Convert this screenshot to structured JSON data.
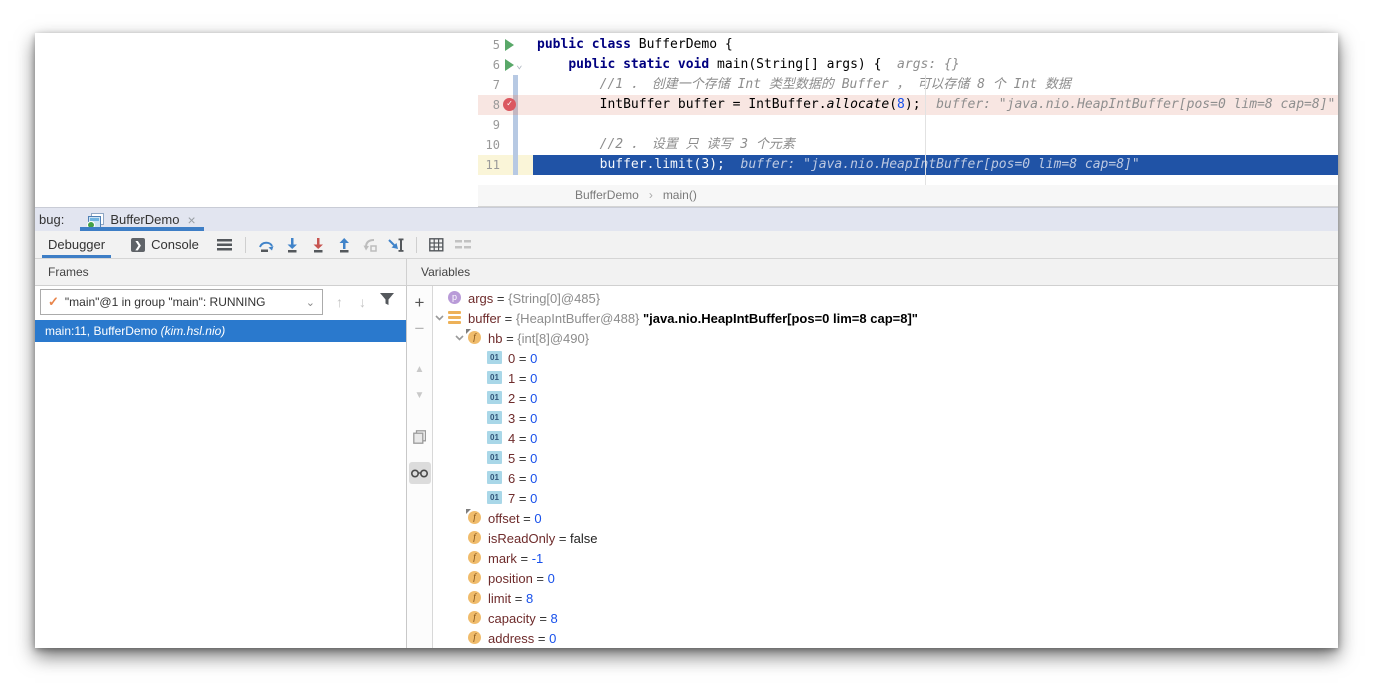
{
  "colors": {
    "accent_blue": "#3E7EC6",
    "exec_line_bg": "#2053A6",
    "breakpoint_line_bg": "#F8E6E2",
    "frame_selection": "#2A79CD",
    "header_lavender": "#E2E5F0",
    "toolbar_gray": "#F2F2F2",
    "keyword": "#000080",
    "number": "#1750EB",
    "comment": "#8C8C8C",
    "var_name": "#6E2B2B",
    "breakpoint_icon": "#DB5860",
    "run_icon": "#59A869"
  },
  "glyphs": {
    "close": "×",
    "chevron_down": "⌄",
    "up_arrow": "↑",
    "down_arrow": "↓",
    "plus": "+",
    "minus": "−",
    "tri_up": "▲",
    "tri_down": "▼",
    "check": "✓",
    "breadcrumb_sep": "›",
    "console_play": "❯",
    "fold": "⌄"
  },
  "editor": {
    "lines": [
      {
        "num": "5",
        "icon": "run",
        "stripe": false,
        "variant": "normal",
        "tokens": [
          {
            "t": "public class ",
            "c": "kw"
          },
          {
            "t": "BufferDemo {",
            "c": "pl"
          }
        ]
      },
      {
        "num": "6",
        "icon": "run",
        "fold": true,
        "stripe": false,
        "variant": "normal",
        "tokens": [
          {
            "t": "    ",
            "c": "pl"
          },
          {
            "t": "public static void ",
            "c": "kw"
          },
          {
            "t": "main(String[] args) {",
            "c": "pl"
          },
          {
            "t": "  args: {}",
            "c": "hint"
          }
        ]
      },
      {
        "num": "7",
        "icon": "",
        "stripe": true,
        "variant": "normal",
        "tokens": [
          {
            "t": "        //1 ． 创建一个存储 Int 类型数据的 Buffer ， 可以存储 8 个 Int 数据",
            "c": "cmt"
          }
        ]
      },
      {
        "num": "8",
        "icon": "bp",
        "stripe": true,
        "variant": "bp",
        "tokens": [
          {
            "t": "        IntBuffer buffer = IntBuffer.",
            "c": "pl"
          },
          {
            "t": "allocate",
            "c": "it"
          },
          {
            "t": "(",
            "c": "pl"
          },
          {
            "t": "8",
            "c": "num"
          },
          {
            "t": ");",
            "c": "pl"
          },
          {
            "t": "  buffer: \"java.nio.HeapIntBuffer[pos=0 lim=8 cap=8]\"",
            "c": "hint"
          }
        ]
      },
      {
        "num": "9",
        "icon": "",
        "stripe": true,
        "variant": "normal",
        "tokens": []
      },
      {
        "num": "10",
        "icon": "",
        "stripe": true,
        "variant": "normal",
        "tokens": [
          {
            "t": "        //2 ． 设置 只 读写 3 个元素",
            "c": "cmt"
          }
        ]
      },
      {
        "num": "11",
        "icon": "",
        "stripe": true,
        "variant": "exec",
        "tokens": [
          {
            "t": "        buffer.limit(",
            "c": "pl"
          },
          {
            "t": "3",
            "c": "num"
          },
          {
            "t": ");",
            "c": "pl"
          },
          {
            "t": "  buffer: \"java.nio.HeapIntBuffer[pos=0 lim=8 cap=8]\"",
            "c": "hint"
          }
        ]
      }
    ],
    "breadcrumb": {
      "class": "BufferDemo",
      "method": "main()"
    }
  },
  "debug_header": {
    "label": "bug:",
    "tab_title": "BufferDemo"
  },
  "toolbar": {
    "debugger_tab": "Debugger",
    "console_tab": "Console",
    "icons": [
      "hamburger-menu",
      "step-over",
      "step-into",
      "force-step-into",
      "step-out",
      "drop-frame",
      "run-to-cursor",
      "view-breakpoints-grid",
      "restore-layout"
    ]
  },
  "panel_headers": {
    "frames": "Frames",
    "variables": "Variables"
  },
  "frames_panel": {
    "thread_selector": "\"main\"@1 in group \"main\": RUNNING",
    "frames": [
      {
        "location": "main:11, BufferDemo ",
        "package": "(kim.hsl.nio)",
        "selected": true
      }
    ]
  },
  "variables_panel": {
    "toolbar": [
      "add-watch",
      "remove-watch",
      "move-up",
      "move-down",
      "duplicate",
      "show-watches"
    ],
    "rows": [
      {
        "level": 0,
        "expand": null,
        "icon": "p",
        "name": "args",
        "value": [
          {
            "t": "{String[0]@485}",
            "c": "ref"
          }
        ]
      },
      {
        "level": 0,
        "expand": "open",
        "icon": "bars",
        "name": "buffer",
        "value": [
          {
            "t": "{HeapIntBuffer@488} ",
            "c": "ref"
          },
          {
            "t": "\"java.nio.HeapIntBuffer[pos=0 lim=8 cap=8]\"",
            "c": "str"
          }
        ]
      },
      {
        "level": 1,
        "expand": "open",
        "icon": "f-final",
        "name": "hb",
        "value": [
          {
            "t": "{int[8]@490}",
            "c": "ref"
          }
        ]
      },
      {
        "level": 2,
        "expand": null,
        "icon": "elem",
        "name": "0",
        "value": [
          {
            "t": "0",
            "c": "numv"
          }
        ]
      },
      {
        "level": 2,
        "expand": null,
        "icon": "elem",
        "name": "1",
        "value": [
          {
            "t": "0",
            "c": "numv"
          }
        ]
      },
      {
        "level": 2,
        "expand": null,
        "icon": "elem",
        "name": "2",
        "value": [
          {
            "t": "0",
            "c": "numv"
          }
        ]
      },
      {
        "level": 2,
        "expand": null,
        "icon": "elem",
        "name": "3",
        "value": [
          {
            "t": "0",
            "c": "numv"
          }
        ]
      },
      {
        "level": 2,
        "expand": null,
        "icon": "elem",
        "name": "4",
        "value": [
          {
            "t": "0",
            "c": "numv"
          }
        ]
      },
      {
        "level": 2,
        "expand": null,
        "icon": "elem",
        "name": "5",
        "value": [
          {
            "t": "0",
            "c": "numv"
          }
        ]
      },
      {
        "level": 2,
        "expand": null,
        "icon": "elem",
        "name": "6",
        "value": [
          {
            "t": "0",
            "c": "numv"
          }
        ]
      },
      {
        "level": 2,
        "expand": null,
        "icon": "elem",
        "name": "7",
        "value": [
          {
            "t": "0",
            "c": "numv"
          }
        ]
      },
      {
        "level": 1,
        "expand": null,
        "icon": "f-final",
        "name": "offset",
        "value": [
          {
            "t": "0",
            "c": "numv"
          }
        ]
      },
      {
        "level": 1,
        "expand": null,
        "icon": "f",
        "name": "isReadOnly",
        "value": [
          {
            "t": "false",
            "c": "boolv"
          }
        ]
      },
      {
        "level": 1,
        "expand": null,
        "icon": "f",
        "name": "mark",
        "value": [
          {
            "t": "-1",
            "c": "numv"
          }
        ]
      },
      {
        "level": 1,
        "expand": null,
        "icon": "f",
        "name": "position",
        "value": [
          {
            "t": "0",
            "c": "numv"
          }
        ]
      },
      {
        "level": 1,
        "expand": null,
        "icon": "f",
        "name": "limit",
        "value": [
          {
            "t": "8",
            "c": "numv"
          }
        ]
      },
      {
        "level": 1,
        "expand": null,
        "icon": "f",
        "name": "capacity",
        "value": [
          {
            "t": "8",
            "c": "numv"
          }
        ]
      },
      {
        "level": 1,
        "expand": null,
        "icon": "f",
        "name": "address",
        "value": [
          {
            "t": "0",
            "c": "numv"
          }
        ]
      }
    ]
  }
}
